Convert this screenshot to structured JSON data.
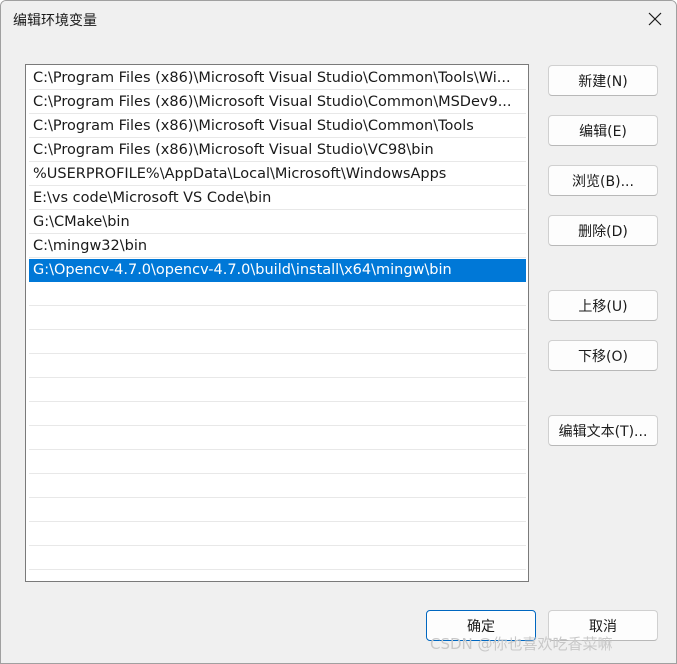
{
  "window": {
    "title": "编辑环境变量",
    "close_icon": "close-icon"
  },
  "path_list": {
    "items": [
      {
        "text": "C:\\Program Files (x86)\\Microsoft Visual Studio\\Common\\Tools\\Wi...",
        "selected": false
      },
      {
        "text": "C:\\Program Files (x86)\\Microsoft Visual Studio\\Common\\MSDev9...",
        "selected": false
      },
      {
        "text": "C:\\Program Files (x86)\\Microsoft Visual Studio\\Common\\Tools",
        "selected": false
      },
      {
        "text": "C:\\Program Files (x86)\\Microsoft Visual Studio\\VC98\\bin",
        "selected": false
      },
      {
        "text": "%USERPROFILE%\\AppData\\Local\\Microsoft\\WindowsApps",
        "selected": false
      },
      {
        "text": "E:\\vs code\\Microsoft VS Code\\bin",
        "selected": false
      },
      {
        "text": "G:\\CMake\\bin",
        "selected": false
      },
      {
        "text": "C:\\mingw32\\bin",
        "selected": false
      },
      {
        "text": "G:\\Opencv-4.7.0\\opencv-4.7.0\\build\\install\\x64\\mingw\\bin",
        "selected": true
      }
    ],
    "selection_color": "#0078d7"
  },
  "side_buttons": {
    "new_label": "新建(N)",
    "edit_label": "编辑(E)",
    "browse_label": "浏览(B)...",
    "delete_label": "删除(D)",
    "move_up_label": "上移(U)",
    "move_down_label": "下移(O)",
    "edit_text_label": "编辑文本(T)..."
  },
  "footer": {
    "ok_label": "确定",
    "cancel_label": "取消",
    "watermark": "CSDN @你也喜欢吃香菜嘛"
  }
}
